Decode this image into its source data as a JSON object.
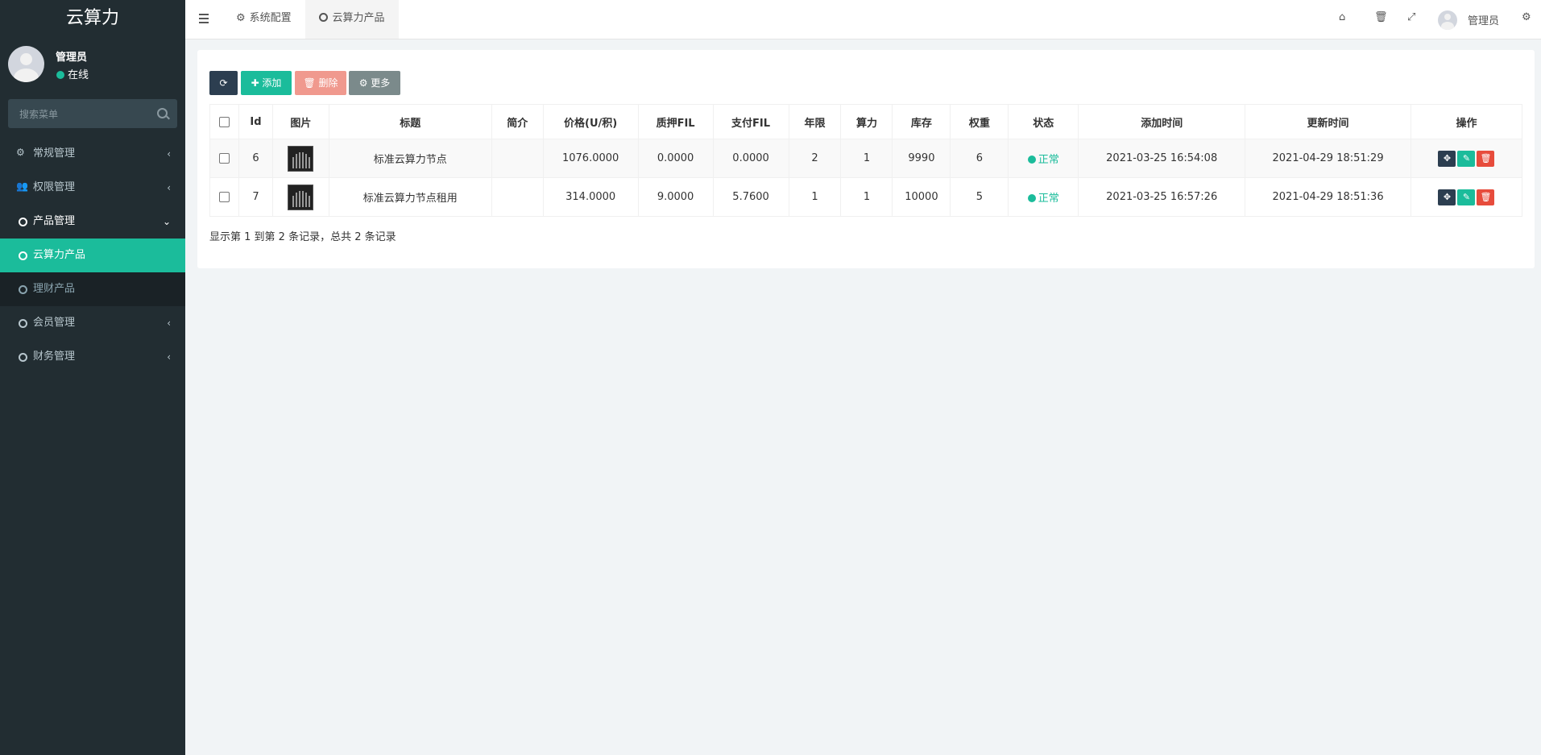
{
  "app": {
    "title": "云算力"
  },
  "user": {
    "name": "管理员",
    "status": "在线"
  },
  "search": {
    "placeholder": "搜索菜单"
  },
  "menu": [
    {
      "label": "常规管理",
      "icon": "cogs-icon",
      "arrow": "‹"
    },
    {
      "label": "权限管理",
      "icon": "users-icon",
      "arrow": "‹"
    },
    {
      "label": "产品管理",
      "icon": "circle-icon",
      "arrow": "⌄"
    },
    {
      "label": "云算力产品",
      "icon": "circle-icon"
    },
    {
      "label": "理财产品",
      "icon": "circle-icon"
    },
    {
      "label": "会员管理",
      "icon": "circle-icon",
      "arrow": "‹"
    },
    {
      "label": "财务管理",
      "icon": "circle-icon",
      "arrow": "‹"
    }
  ],
  "header": {
    "tabs": [
      {
        "label": "系统配置",
        "icon": "gear-icon"
      },
      {
        "label": "云算力产品",
        "icon": "circle-icon"
      }
    ],
    "user_name": "管理员"
  },
  "toolbar": {
    "refresh": "⟳",
    "add": "✚ 添加",
    "delete": "🗑 删除",
    "more": "⚙ 更多"
  },
  "table": {
    "columns": [
      "Id",
      "图片",
      "标题",
      "简介",
      "价格(U/积)",
      "质押FIL",
      "支付FIL",
      "年限",
      "算力",
      "库存",
      "权重",
      "状态",
      "添加时间",
      "更新时间",
      "操作"
    ],
    "rows": [
      {
        "id": "6",
        "title": "标准云算力节点",
        "intro": "",
        "price": "1076.0000",
        "pledge": "0.0000",
        "pay": "0.0000",
        "years": "2",
        "power": "1",
        "stock": "9990",
        "weight": "6",
        "status": "正常",
        "created": "2021-03-25 16:54:08",
        "updated": "2021-04-29 18:51:29"
      },
      {
        "id": "7",
        "title": "标准云算力节点租用",
        "intro": "",
        "price": "314.0000",
        "pledge": "9.0000",
        "pay": "5.7600",
        "years": "1",
        "power": "1",
        "stock": "10000",
        "weight": "5",
        "status": "正常",
        "created": "2021-03-25 16:57:26",
        "updated": "2021-04-29 18:51:36"
      }
    ]
  },
  "pagination": {
    "info": "显示第 1 到第 2 条记录，总共 2 条记录"
  },
  "colors": {
    "accent": "#1bbc9b",
    "sidebar": "#222d32",
    "danger": "#e74c3c",
    "dark": "#2c3e50"
  }
}
